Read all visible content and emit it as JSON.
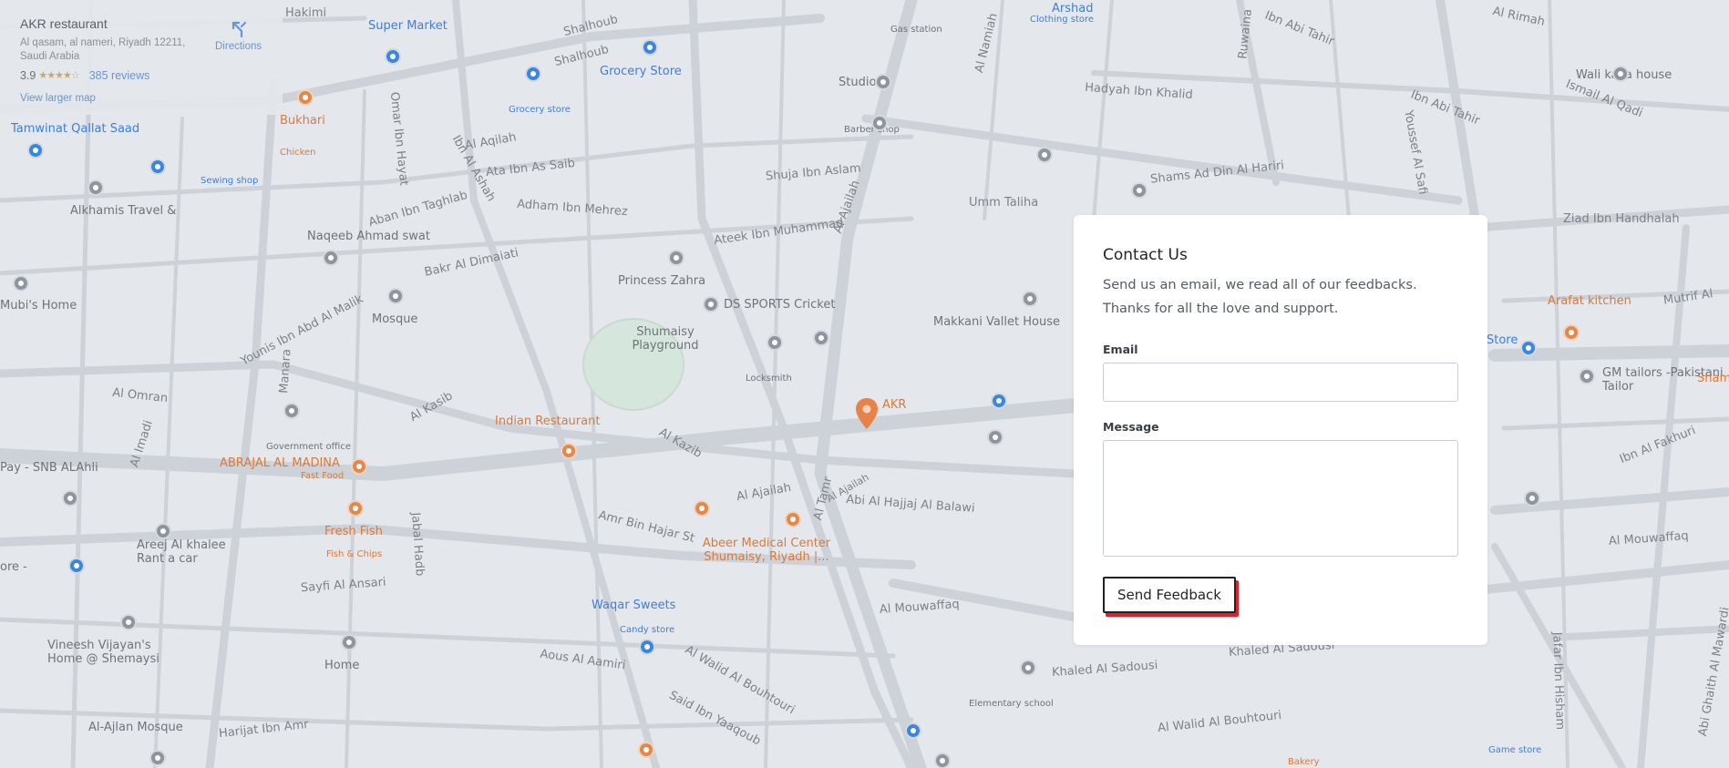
{
  "place_card": {
    "name": "AKR restaurant",
    "address": "Al qasam, al nameri, Riyadh 12211, Saudi Arabia",
    "rating": "3.9",
    "stars": "★★★★☆",
    "reviews": "385 reviews",
    "view_larger_map": "View larger map",
    "directions": "Directions"
  },
  "map": {
    "streets": [
      "Hakimi",
      "Shalhoub",
      "Shalhoub",
      "Al Rimah",
      "Ibn Abi Tahir",
      "Hadyah Ibn Khalid",
      "Ibn Abi Tahir",
      "Ismail Al Qadi",
      "Shams Ad Din Al Hariri",
      "Umm Taliha",
      "Ziad Ibn Handhalah",
      "Al Aqilah",
      "Ata Ibn As Saib",
      "Shuja Ibn Aslam",
      "Adham Ibn Mehrez",
      "Aban Ibn Taghlab",
      "Ateek Ibn Muhammad",
      "Bakr Al Dimaiati",
      "Younis Ibn Abd Al Malik",
      "Al Omran",
      "Al Kasib",
      "Al Kazib",
      "Al Ajailah",
      "Abi Al Hajjaj Al Balawi",
      "Amr Bin Hajar St",
      "Sayfi Al Ansari",
      "Al Mouwaffaq",
      "Al Mouwaffaq",
      "Khaled Al Sadousi",
      "Khaled Al Sadousi",
      "Al Walid Al Bouhtouri",
      "Al Walid Al Bouhtouri",
      "Said Ibn Yaaqoub",
      "Aous Al Aamiri",
      "Harijat Ibn Amr",
      "Ibn Al Fakhuri",
      "Mutrif Al",
      "Al Namiah",
      "Omar Ibn Hayat",
      "Ibn Al Ashah",
      "Al Imadi",
      "Manara",
      "Jabal Hadb",
      "Al Ajailah",
      "Al Tamr",
      "Ruwaina",
      "Youssef Al Safi",
      "Jafar Ibn Hisham",
      "Abi Ghaith Al Mawardi",
      "Al Ajailah"
    ],
    "places": [
      "Super Market",
      "Grocery Store",
      "Grocery store",
      "Studio",
      "Barber shop",
      "Arshad",
      "Clothing store",
      "Gas station",
      "Bukhari",
      "Chicken",
      "Tamwinat Qallat Saad",
      "Sewing shop",
      "Alkhamis Travel &",
      "Naqeeb Ahmad swat",
      "Mubi's Home",
      "Mosque",
      "Princess Zahra",
      "DS SPORTS Cricket",
      "Shumaisy Playground",
      "Locksmith",
      "Makkani Vallet House",
      "Wali kaka house",
      "Arafat kitchen",
      "GM tailors -Pakistani Tailor",
      "Government office",
      "Indian Restaurant",
      "ABRAJAL AL MADINA",
      "Fast Food",
      "Fresh Fish",
      "Fish & Chips",
      "AKR",
      "Abeer Medical Center Shumaisy, Riyadh |...",
      "Areej Al khalee Rant a car",
      "Waqar Sweets",
      "Candy store",
      "Vineesh Vijayan's Home @ Shemaysi",
      "Home",
      "Al-Ajlan Mosque",
      "Elementary school",
      "Bakery",
      "Game store",
      "Store",
      "Sham",
      "Pay - SNB ALAhli",
      "ore -"
    ]
  },
  "contact": {
    "title": "Contact Us",
    "description": "Send us an email, we read all of our feedbacks. Thanks for all the love and support.",
    "email_label": "Email",
    "email_value": "",
    "message_label": "Message",
    "message_value": "",
    "send_label": "Send Feedback"
  }
}
